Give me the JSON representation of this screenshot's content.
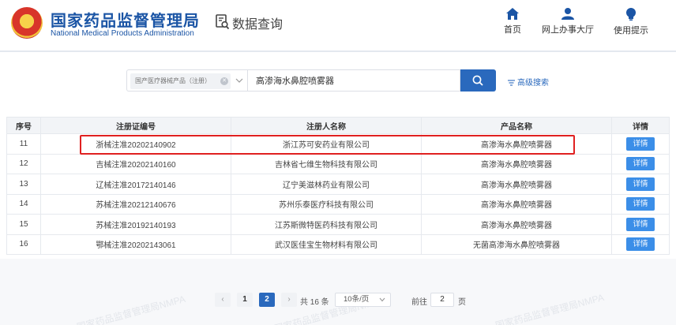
{
  "header": {
    "brand_cn": "国家药品监督管理局",
    "brand_en": "National Medical Products Administration",
    "query_title": "数据查询",
    "nav": [
      {
        "label": "首页",
        "icon": "home-icon"
      },
      {
        "label": "网上办事大厅",
        "icon": "user-icon"
      },
      {
        "label": "使用提示",
        "icon": "lightbulb-icon"
      }
    ]
  },
  "search": {
    "category_chip": "国产医疗器械产品（注册）",
    "query_value": "高渗海水鼻腔喷雾器",
    "advanced_label": "高级搜索"
  },
  "table": {
    "columns": [
      "序号",
      "注册证编号",
      "注册人名称",
      "产品名称",
      "详情"
    ],
    "rows": [
      {
        "no": "11",
        "reg_no": "浙械注准20202140902",
        "registrant": "浙江苏可安药业有限公司",
        "product": "高渗海水鼻腔喷雾器",
        "detail": "详情"
      },
      {
        "no": "12",
        "reg_no": "吉械注准20202140160",
        "registrant": "吉林省七维生物科技有限公司",
        "product": "高渗海水鼻腔喷雾器",
        "detail": "详情"
      },
      {
        "no": "13",
        "reg_no": "辽械注准20172140146",
        "registrant": "辽宁美滋林药业有限公司",
        "product": "高渗海水鼻腔喷雾器",
        "detail": "详情"
      },
      {
        "no": "14",
        "reg_no": "苏械注准20212140676",
        "registrant": "苏州乐泰医疗科技有限公司",
        "product": "高渗海水鼻腔喷雾器",
        "detail": "详情"
      },
      {
        "no": "15",
        "reg_no": "苏械注准20192140193",
        "registrant": "江苏斯微特医药科技有限公司",
        "product": "高渗海水鼻腔喷雾器",
        "detail": "详情"
      },
      {
        "no": "16",
        "reg_no": "鄂械注准20202143061",
        "registrant": "武汉医佳宝生物材料有限公司",
        "product": "无菌高渗海水鼻腔喷雾器",
        "detail": "详情"
      }
    ]
  },
  "pagination": {
    "prev": "‹",
    "pages": [
      "1",
      "2"
    ],
    "current_page": "2",
    "next": "›",
    "total_text": "共 16 条",
    "page_size": "10条/页",
    "goto_prefix": "前往",
    "goto_value": "2",
    "goto_suffix": "页"
  },
  "watermark": "国家药品监督管理局NMPA",
  "colors": {
    "primary": "#2a69bd",
    "detail_button": "#3b8ee8",
    "highlight": "#e02020",
    "brand": "#1b55a5"
  }
}
